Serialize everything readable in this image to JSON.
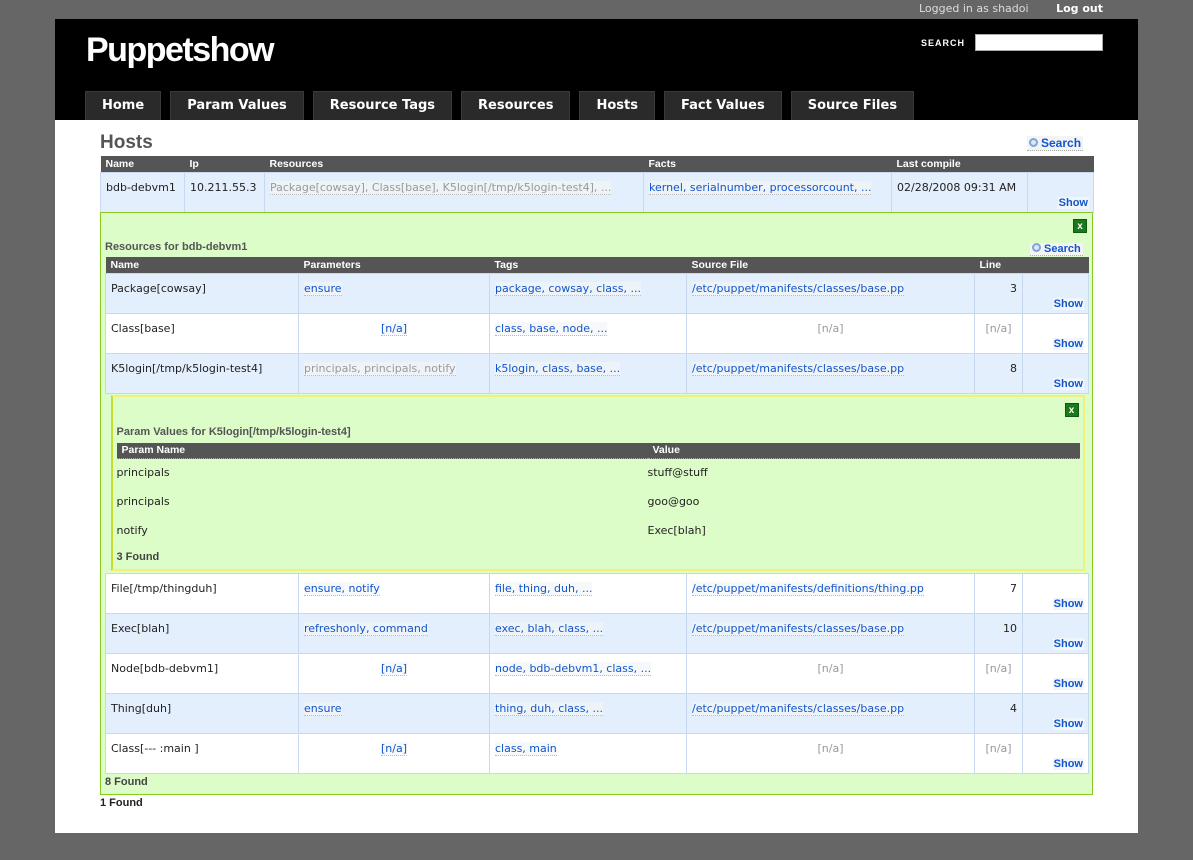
{
  "topbar": {
    "logged_in": "Logged in as shadoi",
    "logout": "Log out"
  },
  "header": {
    "logo": "Puppetshow",
    "search_label": "SEARCH",
    "search_value": ""
  },
  "nav": [
    "Home",
    "Param Values",
    "Resource Tags",
    "Resources",
    "Hosts",
    "Fact Values",
    "Source Files"
  ],
  "page": {
    "title": "Hosts",
    "search_link": "Search",
    "found": "1 Found"
  },
  "hosts": {
    "columns": [
      "Name",
      "Ip",
      "Resources",
      "Facts",
      "Last compile",
      ""
    ],
    "rows": [
      {
        "name": "bdb-debvm1",
        "ip": "10.211.55.3",
        "resources": "Package[cowsay], Class[base], K5login[/tmp/k5login-test4], ...",
        "facts": "kernel, serialnumber, processorcount, ...",
        "last_compile": "02/28/2008 09:31 AM",
        "show": "Show"
      }
    ]
  },
  "resources": {
    "title": "Resources for bdb-debvm1",
    "search_link": "Search",
    "close": "x",
    "found": "8 Found",
    "columns": [
      "Name",
      "Parameters",
      "Tags",
      "Source File",
      "Line",
      ""
    ],
    "rows": [
      {
        "name": "Package[cowsay]",
        "params": "ensure",
        "tags": "package, cowsay, class, ...",
        "file": "/etc/puppet/manifests/classes/base.pp",
        "line": "3",
        "show": "Show"
      },
      {
        "name": "Class[base]",
        "params": "[n/a]",
        "tags": "class, base, node, ...",
        "file": "[n/a]",
        "line": "[n/a]",
        "show": "Show"
      },
      {
        "name": "K5login[/tmp/k5login-test4]",
        "params": "principals, principals, notify",
        "tags": "k5login, class, base, ...",
        "file": "/etc/puppet/manifests/classes/base.pp",
        "line": "8",
        "show": "Show"
      },
      {
        "name": "File[/tmp/thingduh]",
        "params": "ensure, notify",
        "tags": "file, thing, duh, ...",
        "file": "/etc/puppet/manifests/definitions/thing.pp",
        "line": "7",
        "show": "Show"
      },
      {
        "name": "Exec[blah]",
        "params": "refreshonly, command",
        "tags": "exec, blah, class, ...",
        "file": "/etc/puppet/manifests/classes/base.pp",
        "line": "10",
        "show": "Show"
      },
      {
        "name": "Node[bdb-debvm1]",
        "params": "[n/a]",
        "tags": "node, bdb-debvm1, class, ...",
        "file": "[n/a]",
        "line": "[n/a]",
        "show": "Show"
      },
      {
        "name": "Thing[duh]",
        "params": "ensure",
        "tags": "thing, duh, class, ...",
        "file": "/etc/puppet/manifests/classes/base.pp",
        "line": "4",
        "show": "Show"
      },
      {
        "name": "Class[--- :main ]",
        "params": "[n/a]",
        "tags": "class, main",
        "file": "[n/a]",
        "line": "[n/a]",
        "show": "Show"
      }
    ]
  },
  "params": {
    "title": "Param Values for K5login[/tmp/k5login-test4]",
    "close": "x",
    "found": "3 Found",
    "columns": [
      "Param Name",
      "Value"
    ],
    "rows": [
      {
        "name": "principals",
        "value": "stuff@stuff"
      },
      {
        "name": "principals",
        "value": "goo@goo"
      },
      {
        "name": "notify",
        "value": "Exec[blah]"
      }
    ]
  }
}
